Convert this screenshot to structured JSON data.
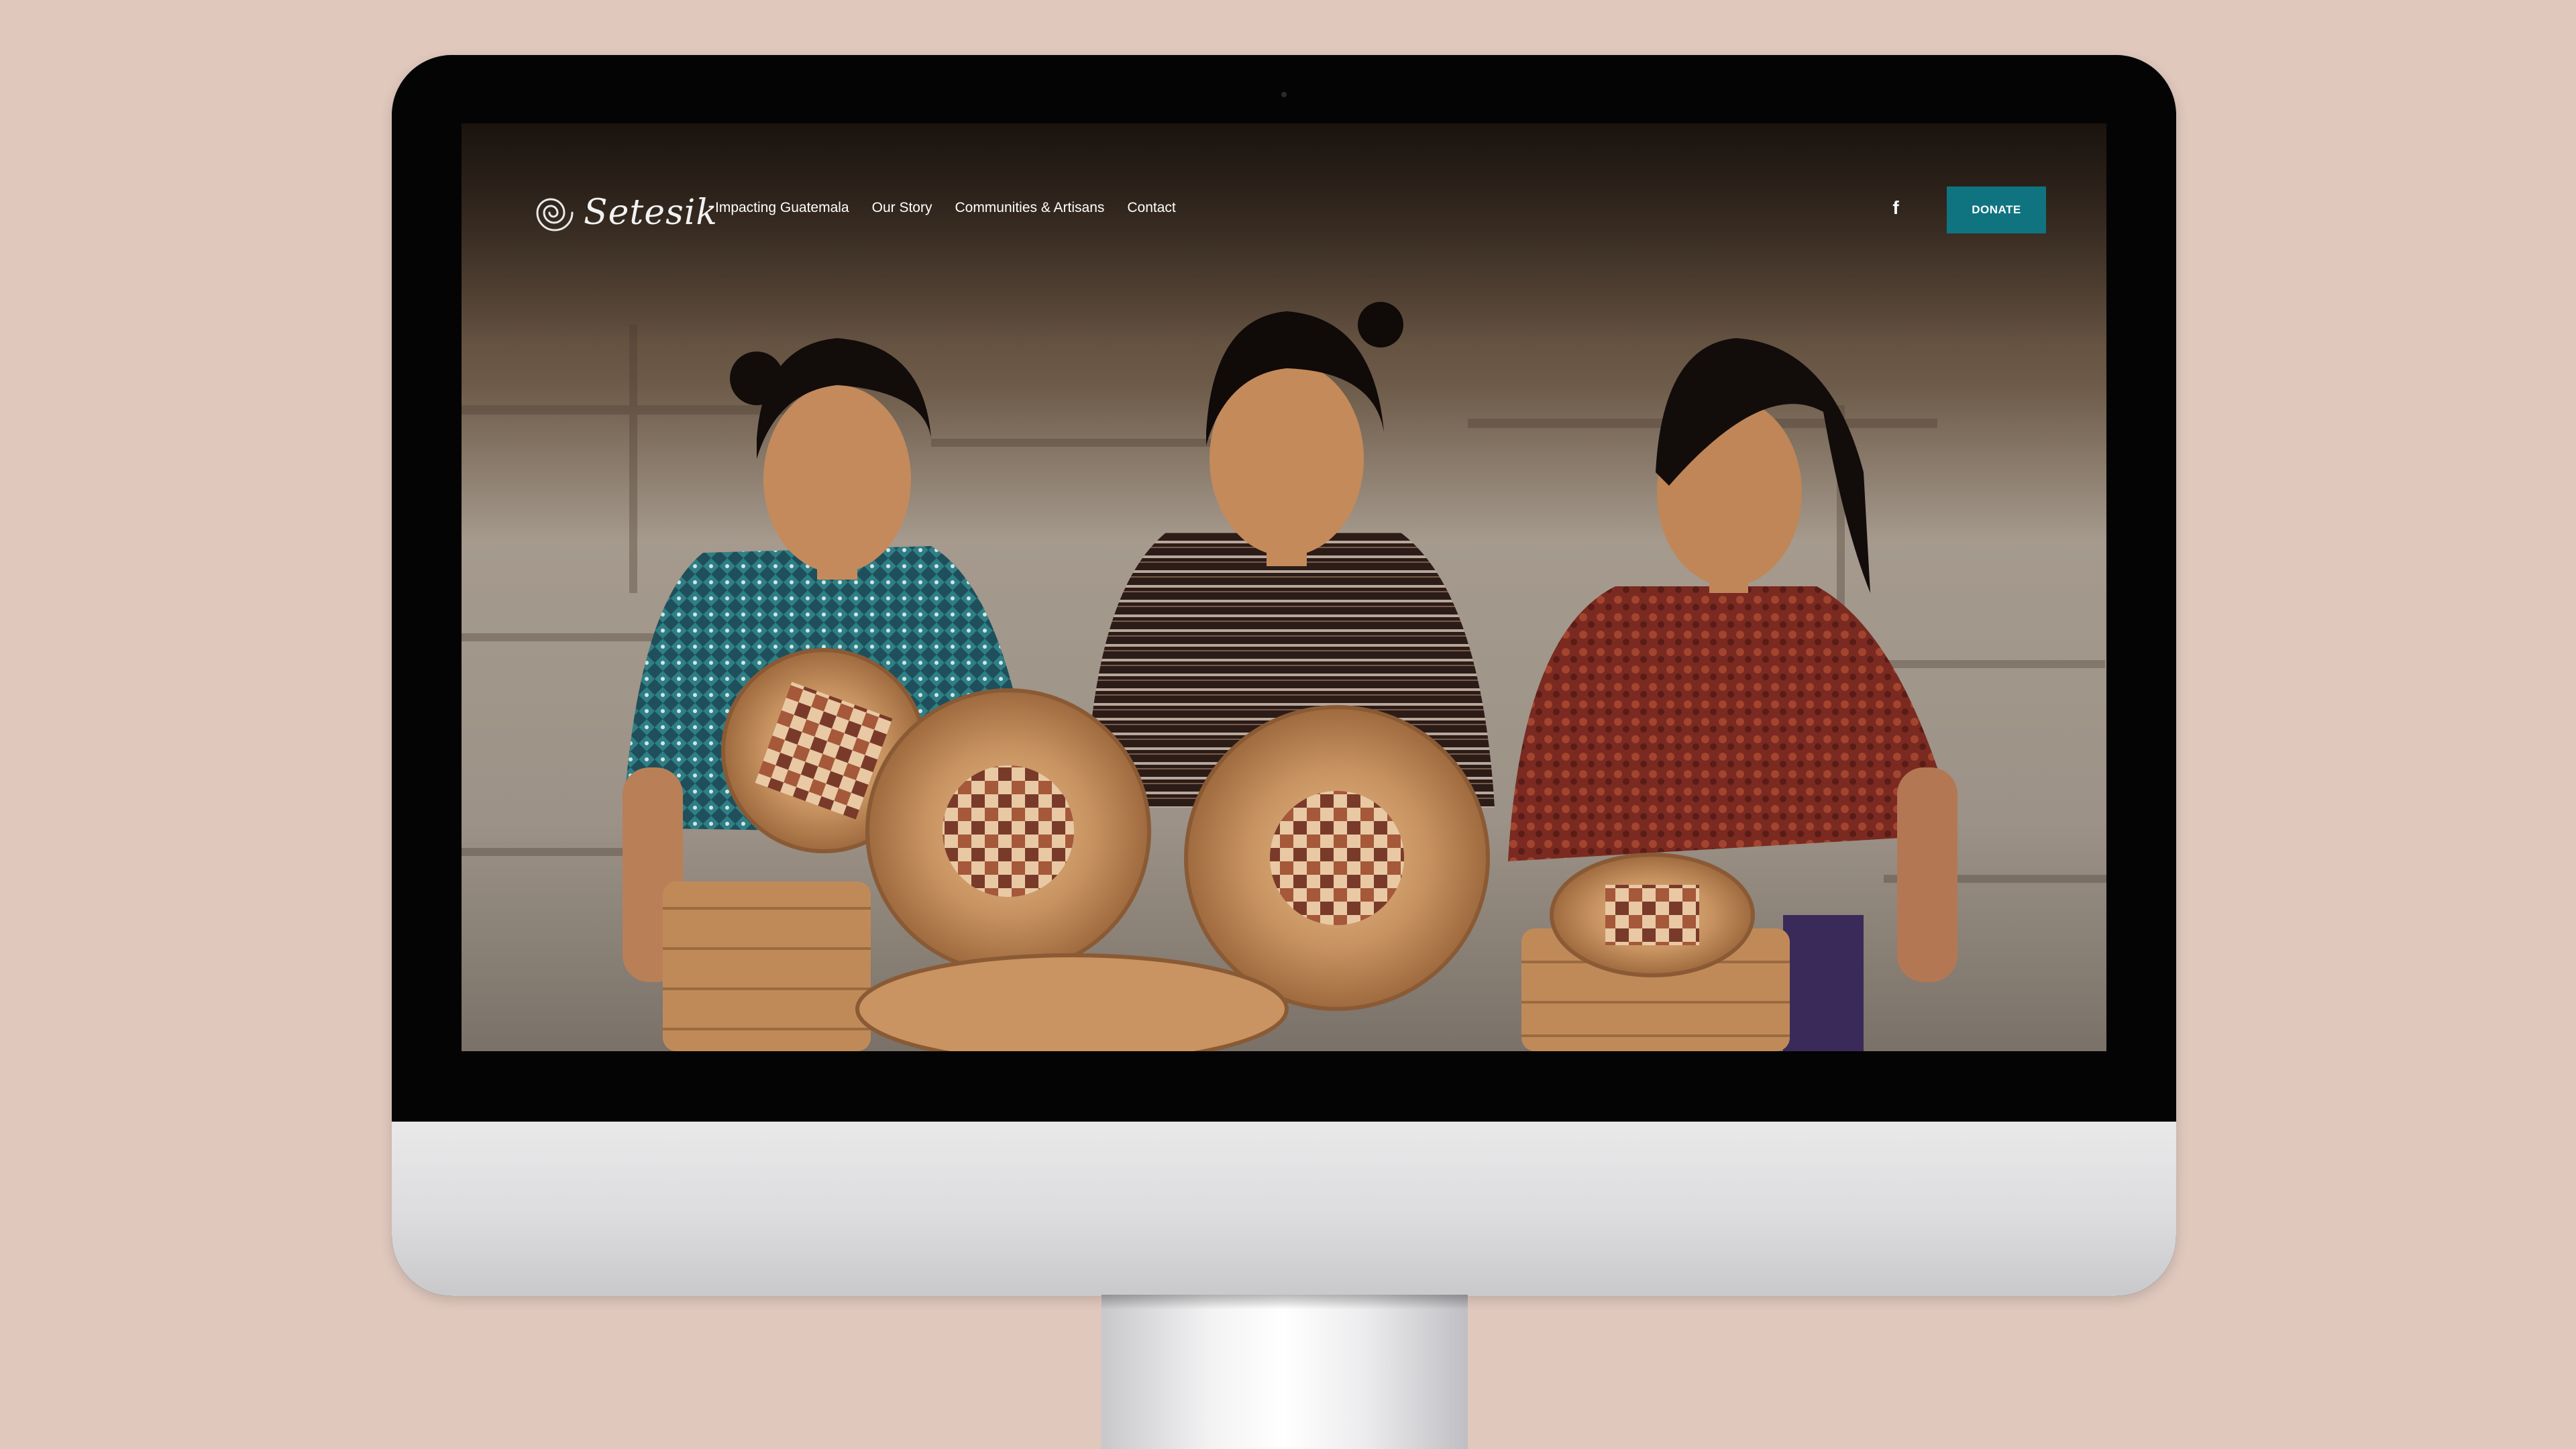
{
  "site": {
    "logo_text": "Setesik",
    "nav": [
      {
        "label": "Impacting Guatemala"
      },
      {
        "label": "Our Story"
      },
      {
        "label": "Communities & Artisans"
      },
      {
        "label": "Contact"
      }
    ],
    "social_icon": "facebook-icon",
    "donate_label": "DONATE"
  },
  "colors": {
    "background": "#e0c8bd",
    "donate": "#0f7480",
    "bezel": "#050405",
    "chin": "#dcdcde"
  },
  "hero": {
    "subject": "three-artisans-with-woven-baskets-photo"
  }
}
